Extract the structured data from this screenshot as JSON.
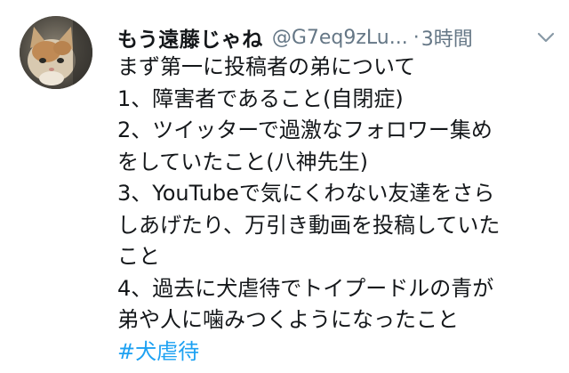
{
  "tweet": {
    "display_name": "もう遠藤じゃね",
    "handle": "@G7eq9zLu...",
    "separator": "·",
    "timestamp": "3時間",
    "lines": [
      "まず第一に投稿者の弟について",
      "1、障害者であること(自閉症)",
      "2、ツイッターで過激なフォロワー集め",
      "をしていたこと(八神先生)",
      "3、YouTubeで気にくわない友達をさら",
      "しあげたり、万引き動画を投稿していた",
      "こと",
      "4、過去に犬虐待でトイプードルの青が",
      "弟や人に噛みつくようになったこと"
    ],
    "hashtag": "#犬虐待",
    "avatar_icon": "cat-avatar",
    "menu_icon": "chevron-down-icon",
    "colors": {
      "text": "#14171a",
      "secondary": "#657786",
      "link": "#1da1f2"
    }
  }
}
